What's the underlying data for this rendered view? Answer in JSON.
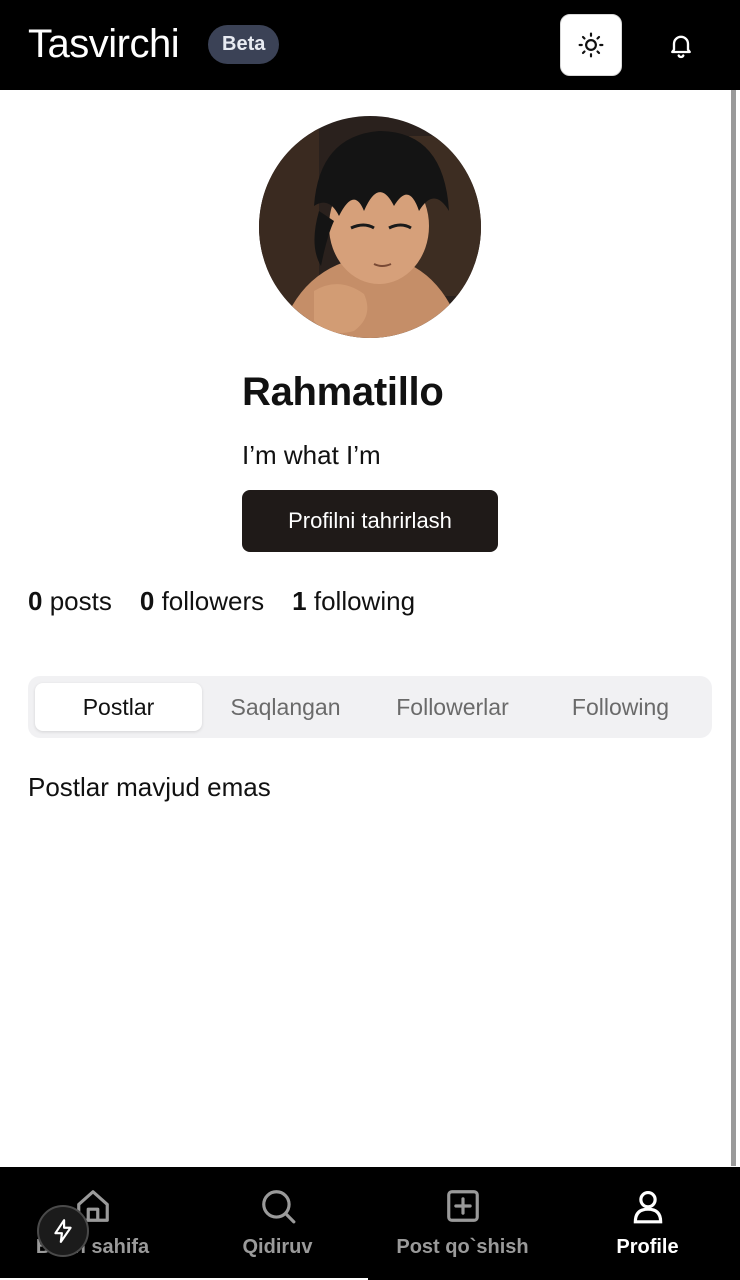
{
  "header": {
    "app_title": "Tasvirchi",
    "badge": "Beta",
    "theme_icon": "sun-icon",
    "notification_icon": "bell-icon"
  },
  "profile": {
    "username": "Rahmatillo",
    "bio": "I’m what I’m",
    "edit_button": "Profilni tahrirlash",
    "stats": [
      {
        "count": "0",
        "label": "posts"
      },
      {
        "count": "0",
        "label": "followers"
      },
      {
        "count": "1",
        "label": "following"
      }
    ]
  },
  "tabs": [
    {
      "label": "Postlar",
      "active": true
    },
    {
      "label": "Saqlangan",
      "active": false
    },
    {
      "label": "Followerlar",
      "active": false
    },
    {
      "label": "Following",
      "active": false
    }
  ],
  "content": {
    "empty_message": "Postlar mavjud emas"
  },
  "bottom_nav": [
    {
      "label": "Bosh sahifa",
      "icon": "home-icon",
      "active": false
    },
    {
      "label": "Qidiruv",
      "icon": "search-icon",
      "active": false
    },
    {
      "label": "Post qo`shish",
      "icon": "plus-square-icon",
      "active": false
    },
    {
      "label": "Profile",
      "icon": "user-icon",
      "active": true
    }
  ],
  "fab": {
    "icon": "lightning-icon"
  },
  "colors": {
    "header_bg": "#000000",
    "badge_bg": "#3b4256",
    "button_bg": "#1f1a18",
    "tabs_bg": "#f1f1f3",
    "inactive_nav": "#9a9a9a"
  }
}
